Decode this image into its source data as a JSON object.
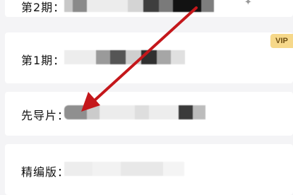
{
  "episodes": [
    {
      "label": "第2期：",
      "blur_colors": [
        "#c8c8c8",
        "#8a8a8a",
        "#ececec",
        "#d4d4d4",
        "#3e3e3e",
        "#7a7a7a",
        "#121212",
        "#121212",
        "#7e7e7e"
      ]
    },
    {
      "label": "第1期：",
      "blur_colors": [
        "#ededed",
        "#9a9a9a",
        "#555555",
        "#cfcfcf",
        "#303030",
        "#a6a6a6",
        "#e0e0e0"
      ]
    },
    {
      "label": "先导片：",
      "blur_colors": [
        "#8f8f8f",
        "#9b9b9b",
        "#dedede",
        "#ececec",
        "#cbcbcb",
        "#ededed",
        "#3a3a3a",
        "#bcbcbc"
      ]
    },
    {
      "label": "精编版：",
      "blur_colors": [
        "#ededed",
        "#f2f2f2",
        "#e8e8e8",
        "#f4f4f4",
        "#eeeeee"
      ]
    }
  ],
  "badge": {
    "text": "VIP",
    "color": "#f6d88a"
  },
  "arrow": {
    "color": "#c4171b"
  },
  "icons": {
    "top_right": "sparkle-icon"
  }
}
